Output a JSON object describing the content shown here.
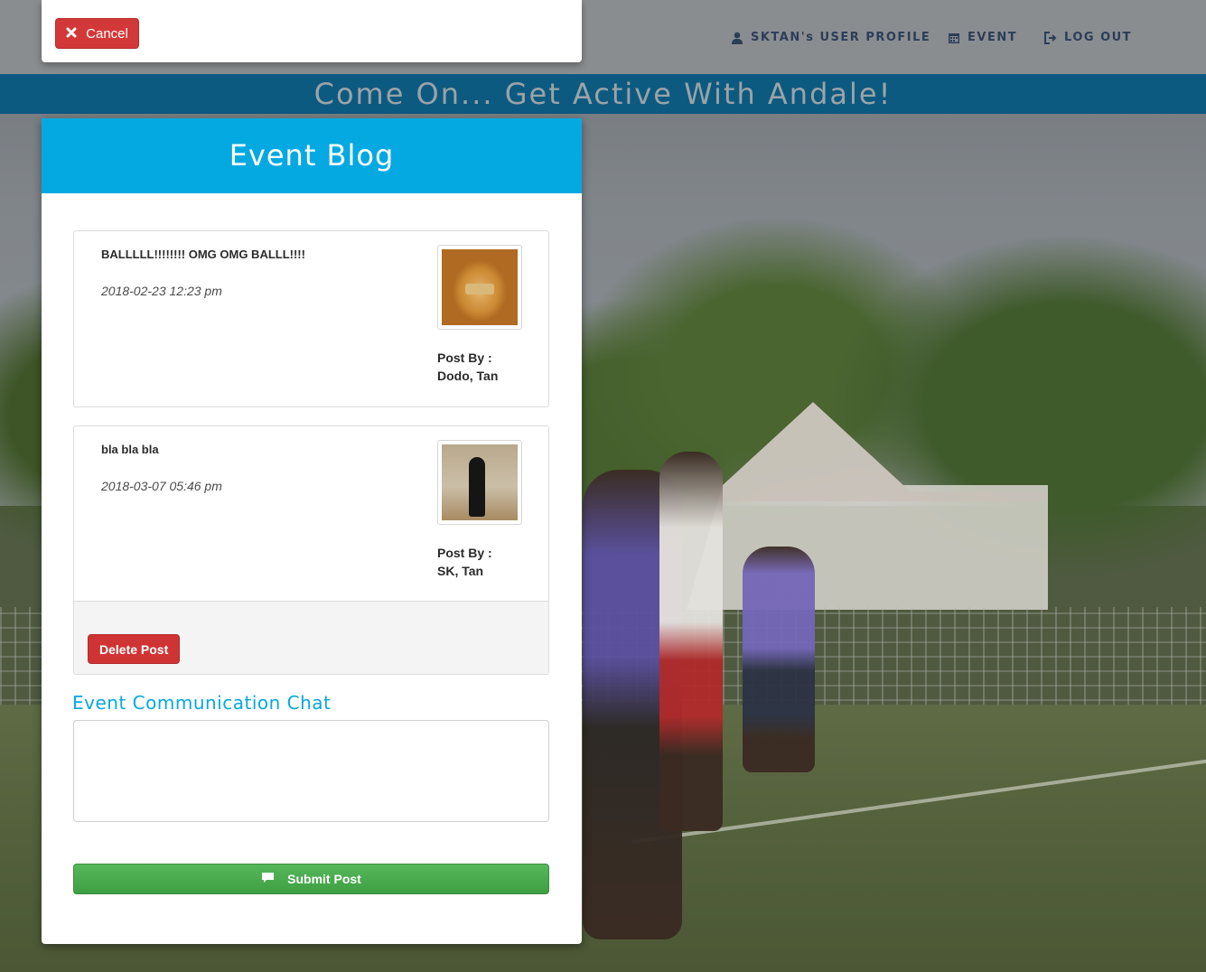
{
  "colors": {
    "header_bar": "#8a8d90",
    "banner_bg": "#0d5a80",
    "blog_header": "#04a9e2",
    "danger_button": "#d33838",
    "success_button": "#4caf50",
    "nav_text": "#2b3e58"
  },
  "nav": {
    "items": [
      {
        "label": "SKTAN's USER PROFILE",
        "icon": "user-icon"
      },
      {
        "label": "EVENT",
        "icon": "calendar-icon"
      },
      {
        "label": "LOG OUT",
        "icon": "sign-out-icon"
      }
    ]
  },
  "banner": {
    "text": "Come On... Get Active With Andale!"
  },
  "cancel_modal": {
    "cancel_label": "Cancel",
    "cancel_icon": "close-icon"
  },
  "blog": {
    "title": "Event Blog",
    "posts": [
      {
        "message": "BALLLLL!!!!!!!! OMG OMG BALLL!!!!",
        "date": "2018-02-23 12:23 pm",
        "post_by_label": "Post By :",
        "author": "Dodo, Tan",
        "avatar": "dog-photo"
      },
      {
        "message": "bla bla bla",
        "date": "2018-03-07 05:46 pm",
        "post_by_label": "Post By :",
        "author": "SK, Tan",
        "avatar": "man-badminton-photo",
        "delete_label": "Delete Post"
      }
    ],
    "chat": {
      "title": "Event Communication Chat",
      "input_value": "",
      "submit_label": "Submit Post",
      "submit_icon": "comment-icon"
    }
  }
}
